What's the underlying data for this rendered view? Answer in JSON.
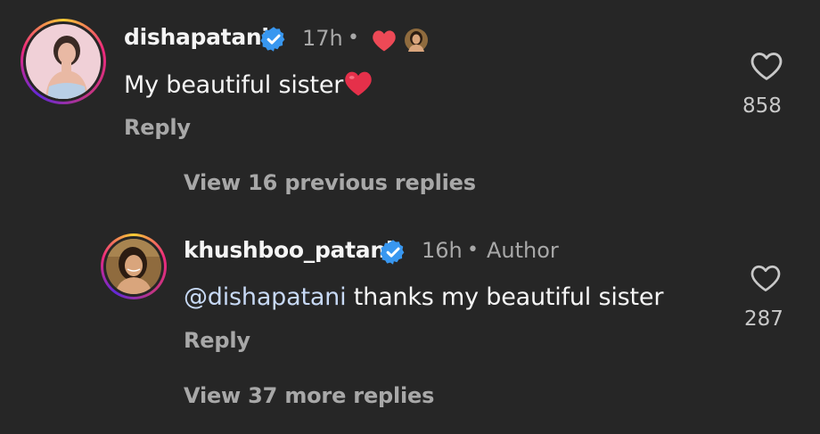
{
  "comments": [
    {
      "username": "dishapatani",
      "time": "17h",
      "separator": "•",
      "text": "My beautiful sister",
      "emoji": "❤️",
      "reply_label": "Reply",
      "likes": "858",
      "avatar_colors": {
        "skin": "#e9b9a4",
        "bg": "#f0d0d7",
        "hair": "#3a2a24",
        "top": "#b9cfe6"
      }
    },
    {
      "username": "khushboo_patani",
      "time": "16h",
      "separator": "•",
      "tag": "Author",
      "mention": "@dishapatani",
      "text": " thanks my beautiful sister",
      "reply_label": "Reply",
      "likes": "287",
      "avatar_colors": {
        "skin": "#d9a57c",
        "bg": "#8f6b3e",
        "hair": "#2b1c12"
      }
    }
  ],
  "view_previous": "View 16 previous replies",
  "view_more": "View 37 more replies",
  "colors": {
    "background": "#262626",
    "text_primary": "#f5f5f5",
    "text_secondary": "#a8a8a8",
    "verified": "#3897f0",
    "heart_red": "#ed4956",
    "mention": "#c7d9f5"
  },
  "icons": {
    "verified": "verified-badge-icon",
    "creator_like": "red-heart-icon",
    "like": "heart-outline-icon"
  }
}
